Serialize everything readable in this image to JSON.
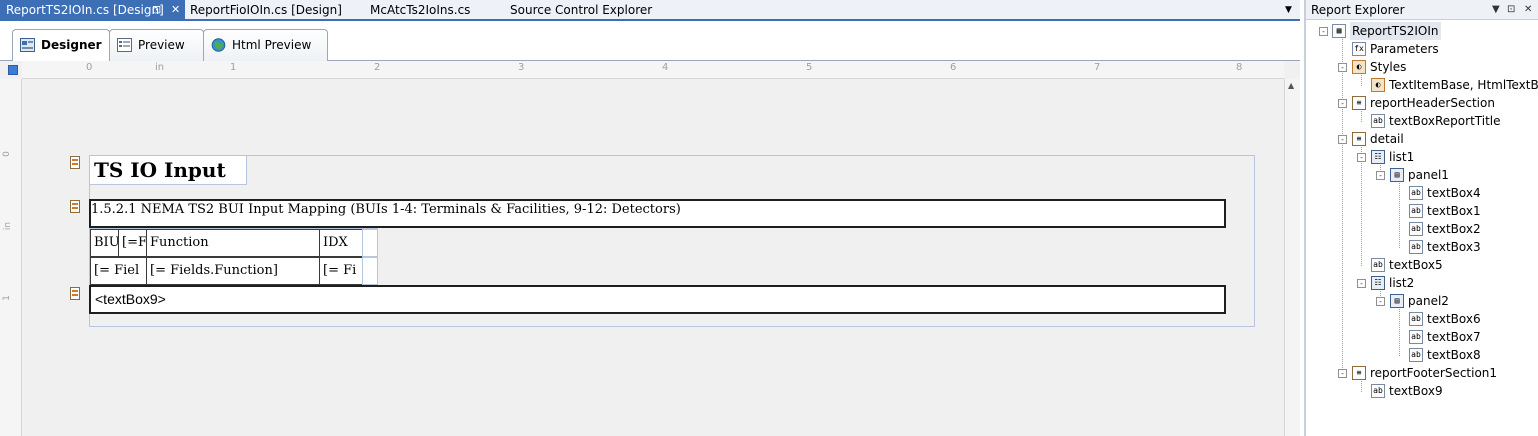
{
  "doc_tabs": [
    {
      "label": "ReportTS2IOIn.cs [Design]",
      "active": true
    },
    {
      "label": "ReportFioIOIn.cs [Design]",
      "active": false
    },
    {
      "label": "McAtcTs2IoIns.cs",
      "active": false
    },
    {
      "label": "Source Control Explorer",
      "active": false
    }
  ],
  "designer_tabs": [
    {
      "label": "Designer",
      "icon": "designer-icon",
      "active": true
    },
    {
      "label": "Preview",
      "icon": "preview-icon",
      "active": false
    },
    {
      "label": "Html Preview",
      "icon": "globe-icon",
      "active": false
    }
  ],
  "ruler": {
    "h_labels": [
      "0",
      "in",
      "1",
      "2",
      "3",
      "4",
      "5",
      "6",
      "7",
      "8"
    ],
    "v_labels": [
      "0",
      "in",
      "1"
    ]
  },
  "report": {
    "title": "TS IO Input",
    "heading": "1.5.2.1 NEMA TS2 BUI Input Mapping (BUIs 1-4: Terminals & Facilities, 9-12: Detectors)",
    "header_cells": [
      "BIU",
      "[=F",
      "Function",
      "IDX",
      ""
    ],
    "row_cells": [
      "[= Fiel",
      "[= Fields.Function]",
      "[= Fi",
      ""
    ],
    "footer_text": "<textBox9>"
  },
  "explorer": {
    "title": "Report Explorer",
    "nodes": [
      {
        "label": "ReportTS2IOIn",
        "icon": "report-icon",
        "expander": "-"
      },
      {
        "label": "Parameters",
        "icon": "parameters-icon",
        "expander": ""
      },
      {
        "label": "Styles",
        "icon": "styles-icon",
        "expander": "-"
      },
      {
        "label": "TextItemBase, HtmlTextBox",
        "icon": "style-item-icon",
        "expander": ""
      },
      {
        "label": "reportHeaderSection",
        "icon": "section-icon",
        "expander": "-"
      },
      {
        "label": "textBoxReportTitle",
        "icon": "textbox-icon",
        "expander": ""
      },
      {
        "label": "detail",
        "icon": "section-icon",
        "expander": "-"
      },
      {
        "label": "list1",
        "icon": "list-icon",
        "expander": "-"
      },
      {
        "label": "panel1",
        "icon": "panel-icon",
        "expander": "-"
      },
      {
        "label": "textBox4",
        "icon": "textbox-icon",
        "expander": ""
      },
      {
        "label": "textBox1",
        "icon": "textbox-icon",
        "expander": ""
      },
      {
        "label": "textBox2",
        "icon": "textbox-icon",
        "expander": ""
      },
      {
        "label": "textBox3",
        "icon": "textbox-icon",
        "expander": ""
      },
      {
        "label": "textBox5",
        "icon": "textbox-icon",
        "expander": ""
      },
      {
        "label": "list2",
        "icon": "list-icon",
        "expander": "-"
      },
      {
        "label": "panel2",
        "icon": "panel-icon",
        "expander": "-"
      },
      {
        "label": "textBox6",
        "icon": "textbox-icon",
        "expander": ""
      },
      {
        "label": "textBox7",
        "icon": "textbox-icon",
        "expander": ""
      },
      {
        "label": "textBox8",
        "icon": "textbox-icon",
        "expander": ""
      },
      {
        "label": "reportFooterSection1",
        "icon": "section-icon",
        "expander": "-"
      },
      {
        "label": "textBox9",
        "icon": "textbox-icon",
        "expander": ""
      }
    ]
  },
  "colors": {
    "accent": "#3d6fb6",
    "surface": "#f0f0f0",
    "selection_border": "#b7c6dc"
  }
}
